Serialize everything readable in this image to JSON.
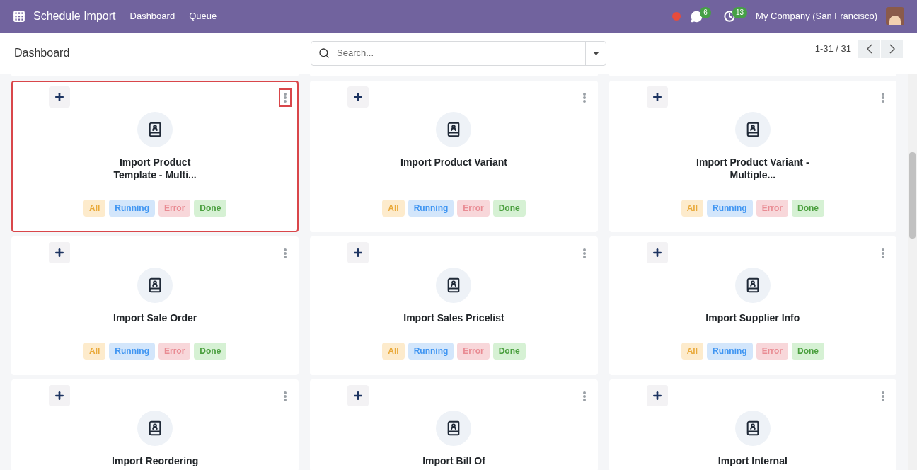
{
  "navbar": {
    "app_title": "Schedule Import",
    "menu": [
      {
        "label": "Dashboard"
      },
      {
        "label": "Queue"
      }
    ],
    "messages_count": "6",
    "activities_count": "13",
    "company": "My Company (San Francisco)"
  },
  "control_panel": {
    "breadcrumb": "Dashboard",
    "search": {
      "placeholder": "Search..."
    },
    "pager": "1-31 / 31"
  },
  "cards": [
    {
      "title": "Import Product Template - Multi...",
      "selected": true,
      "badges": [
        {
          "label": "All",
          "kind": "all"
        },
        {
          "label": "Running",
          "kind": "running"
        },
        {
          "label": "Error",
          "kind": "error"
        },
        {
          "label": "Done",
          "kind": "done"
        }
      ]
    },
    {
      "title": "Import Product Variant",
      "selected": false,
      "badges": [
        {
          "label": "All",
          "kind": "all"
        },
        {
          "label": "Running",
          "kind": "running"
        },
        {
          "label": "Error",
          "kind": "error"
        },
        {
          "label": "Done",
          "kind": "done"
        }
      ]
    },
    {
      "title": "Import Product Variant - Multiple...",
      "selected": false,
      "badges": [
        {
          "label": "All",
          "kind": "all"
        },
        {
          "label": "Running",
          "kind": "running"
        },
        {
          "label": "Error",
          "kind": "error"
        },
        {
          "label": "Done",
          "kind": "done"
        }
      ]
    },
    {
      "title": "Import Sale Order",
      "selected": false,
      "badges": [
        {
          "label": "All",
          "kind": "all"
        },
        {
          "label": "Running",
          "kind": "running"
        },
        {
          "label": "Error",
          "kind": "error"
        },
        {
          "label": "Done",
          "kind": "done"
        }
      ]
    },
    {
      "title": "Import Sales Pricelist",
      "selected": false,
      "badges": [
        {
          "label": "All",
          "kind": "all"
        },
        {
          "label": "Running",
          "kind": "running"
        },
        {
          "label": "Error",
          "kind": "error"
        },
        {
          "label": "Done",
          "kind": "done"
        }
      ]
    },
    {
      "title": "Import Supplier Info",
      "selected": false,
      "badges": [
        {
          "label": "All",
          "kind": "all"
        },
        {
          "label": "Running",
          "kind": "running"
        },
        {
          "label": "Error",
          "kind": "error"
        },
        {
          "label": "Done",
          "kind": "done"
        }
      ]
    },
    {
      "title": "Import Reordering",
      "selected": false
    },
    {
      "title": "Import Bill Of",
      "selected": false
    },
    {
      "title": "Import Internal",
      "selected": false
    }
  ]
}
